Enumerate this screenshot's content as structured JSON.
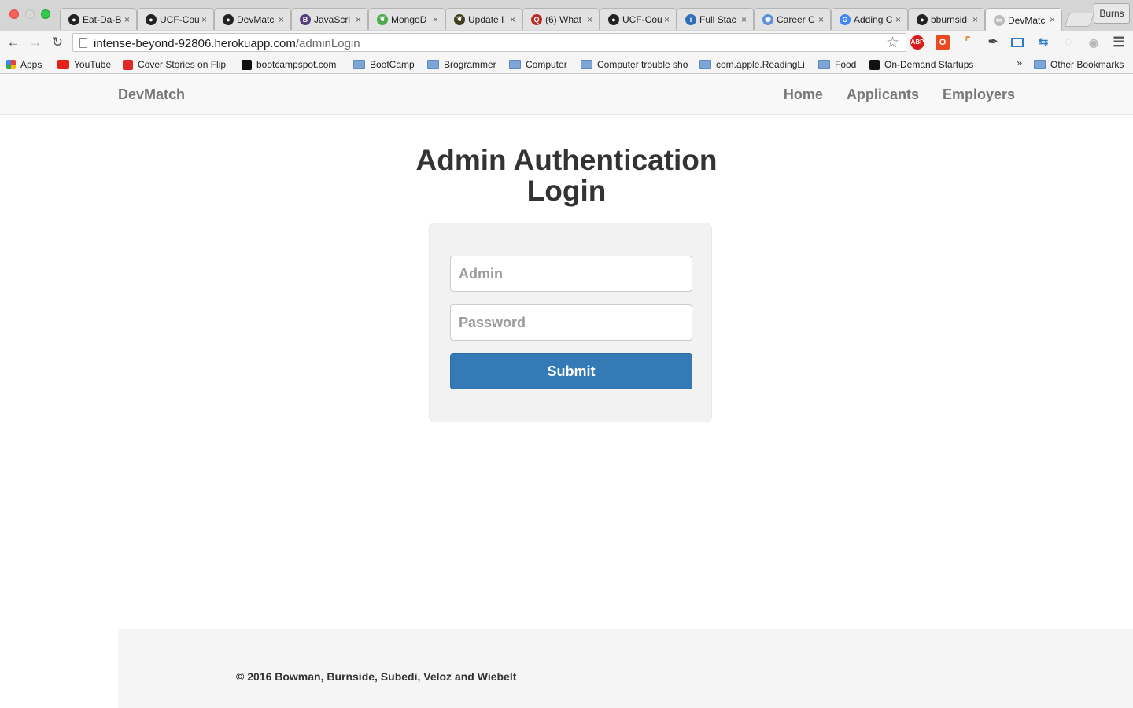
{
  "browser": {
    "tabs": [
      {
        "title": "Eat-Da-B",
        "icon": "github-icon",
        "color": "#222222"
      },
      {
        "title": "UCF-Cou",
        "icon": "github-icon",
        "color": "#222222"
      },
      {
        "title": "DevMatc",
        "icon": "github-icon",
        "color": "#222222"
      },
      {
        "title": "JavaScri",
        "icon": "bootstrap-icon",
        "color": "#563d7c"
      },
      {
        "title": "MongoD",
        "icon": "mongodb-icon",
        "color": "#4fa94d"
      },
      {
        "title": "Update I",
        "icon": "mongodb-icon",
        "color": "#3f3f1e"
      },
      {
        "title": "(6) What",
        "icon": "quora-icon",
        "color": "#b92b27"
      },
      {
        "title": "UCF-Cou",
        "icon": "github-icon",
        "color": "#222222"
      },
      {
        "title": "Full Stac",
        "icon": "info-icon",
        "color": "#2e6fb7"
      },
      {
        "title": "Career C",
        "icon": "career-icon",
        "color": "#5b8fd6"
      },
      {
        "title": "Adding C",
        "icon": "google-icon",
        "color": "#4285f4"
      },
      {
        "title": "bburnsid",
        "icon": "github-icon",
        "color": "#222222"
      },
      {
        "title": "DevMatc",
        "icon": "page-icon",
        "color": "#bbbbbb"
      }
    ],
    "profile_name": "Burns",
    "url_host": "intense-beyond-92806.herokuapp.com",
    "url_path": "/adminLogin",
    "bookmarks": [
      {
        "label": "Apps",
        "type": "apps"
      },
      {
        "label": "YouTube",
        "type": "youtube"
      },
      {
        "label": "Cover Stories on Flip",
        "type": "flipboard"
      },
      {
        "label": "bootcampspot.com",
        "type": "site"
      },
      {
        "label": "BootCamp",
        "type": "folder"
      },
      {
        "label": "Brogrammer",
        "type": "folder"
      },
      {
        "label": "Computer",
        "type": "folder"
      },
      {
        "label": "Computer trouble sho",
        "type": "folder"
      },
      {
        "label": "com.apple.ReadingLi",
        "type": "folder"
      },
      {
        "label": "Food",
        "type": "folder"
      },
      {
        "label": "On-Demand Startups",
        "type": "site"
      }
    ],
    "bookmarks_more": "»",
    "other_bookmarks": "Other Bookmarks"
  },
  "navbar": {
    "brand": "DevMatch",
    "links": [
      "Home",
      "Applicants",
      "Employers"
    ]
  },
  "login": {
    "title_line1": "Admin Authentication",
    "title_line2": "Login",
    "admin_placeholder": "Admin",
    "password_placeholder": "Password",
    "submit_label": "Submit"
  },
  "footer": {
    "copyright": "© 2016 Bowman, Burnside, Subedi, Veloz and Wiebelt"
  },
  "colors": {
    "primary_button": "#337ab7",
    "navbar_bg": "#f8f8f8",
    "well_bg": "#f2f2f2"
  }
}
